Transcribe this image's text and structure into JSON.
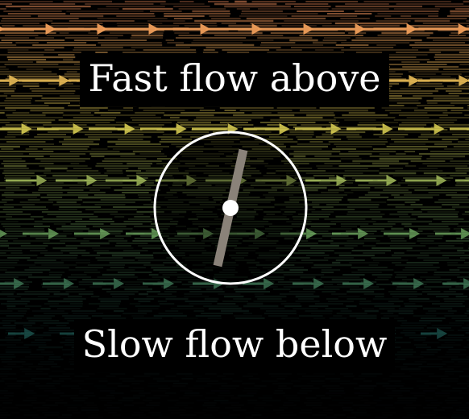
{
  "labels": {
    "top": "Fast flow above",
    "bottom": "Slow flow below"
  },
  "colors": {
    "background": "#000000",
    "fast_flow": "#f08a5a",
    "mid_flow_yellow": "#f3e35a",
    "mid_flow_green": "#8fd67a",
    "slow_flow": "#2f8f86",
    "wheel_outline": "#ffffff",
    "paddle": "#8a8279",
    "axle": "#ffffff",
    "caption_text": "#ffffff"
  },
  "icons": {
    "flow_marker": "arrow-right-icon",
    "paddle_wheel": "paddle-wheel-icon"
  }
}
